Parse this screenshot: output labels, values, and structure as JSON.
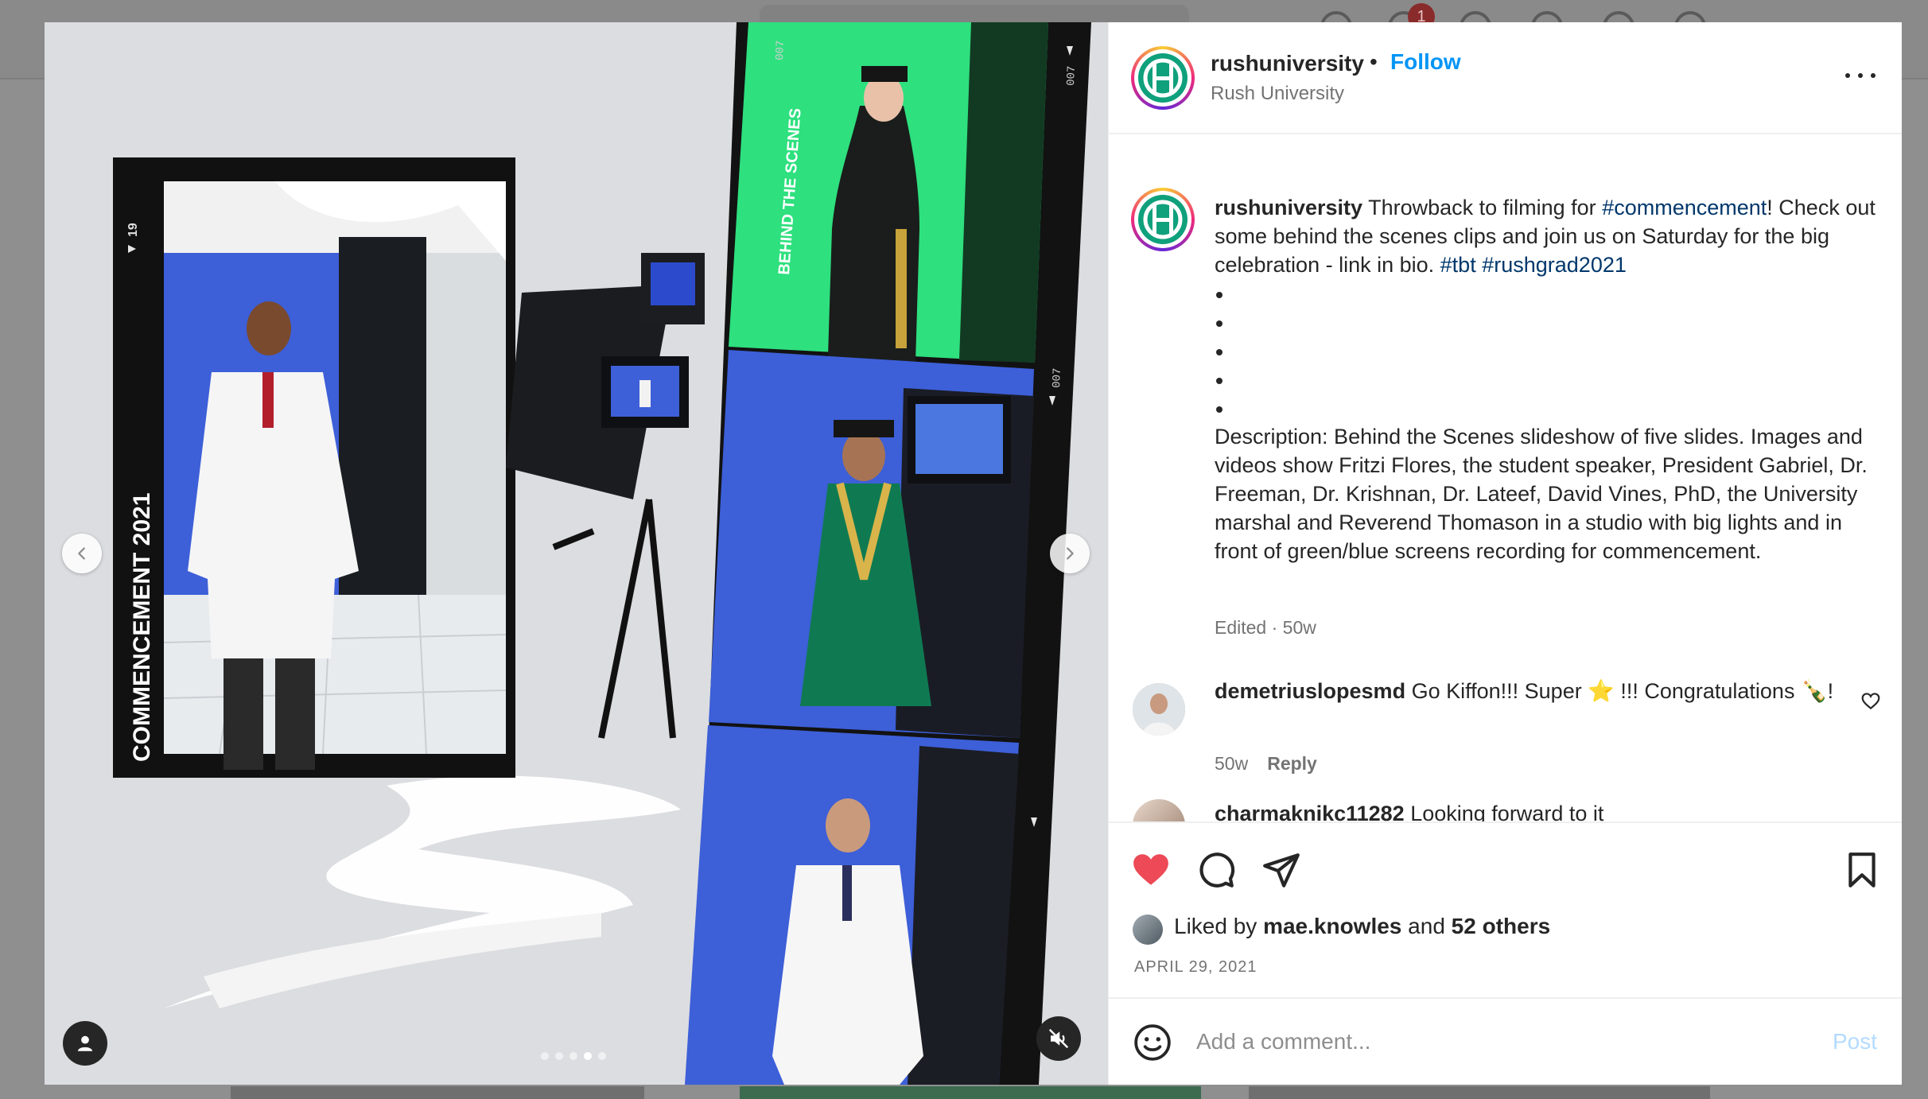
{
  "background": {
    "notification_count": "1"
  },
  "post": {
    "username": "rushuniversity",
    "follow_label": "Follow",
    "subtitle": "Rush University",
    "more_icon": "more-horizontal-icon",
    "caption": {
      "username": "rushuniversity",
      "text_1": "Throwback to filming for ",
      "tag_1": "#commencement",
      "text_2": "! Check out some behind the scenes clips and join us on Saturday for the big celebration - link in bio. ",
      "tag_2": "#tbt",
      "tag_3": "#rushgrad2021",
      "bullet_count": 5,
      "description": "Description: Behind the Scenes slideshow of five slides. Images and videos show Fritzi Flores, the student speaker, President Gabriel, Dr. Freeman, Dr. Krishnan, Dr. Lateef, David Vines, PhD, the University marshal and Reverend Thomason in a studio with big lights and in front of green/blue screens recording for commencement.",
      "meta": "Edited · 50w"
    },
    "comments": [
      {
        "username": "demetriuslopesmd",
        "text": "Go Kiffon!!! Super ⭐ !!! Congratulations 🍾!",
        "time": "50w",
        "reply_label": "Reply"
      },
      {
        "username": "charmaknikc11282",
        "text": "Looking forward to it"
      }
    ],
    "liked_by": {
      "prefix": "Liked by",
      "user": "mae.knowles",
      "joiner": "and",
      "others": "52 others"
    },
    "date": "APRIL 29, 2021",
    "add_comment_placeholder": "Add a comment...",
    "post_label": "Post"
  },
  "media": {
    "text_commencement": "COMMENCEMENT 2021",
    "text_behind_scenes": "BEHIND THE SCENES",
    "frame_number_1": "19",
    "frame_number_2": "007",
    "slide_count": 5,
    "active_slide": 4
  },
  "colors": {
    "like": "#ed4956",
    "follow": "#0095f6",
    "hashtag": "#00376b",
    "green_screen": "#2ee07e",
    "blue_screen": "#3d5fd8"
  }
}
